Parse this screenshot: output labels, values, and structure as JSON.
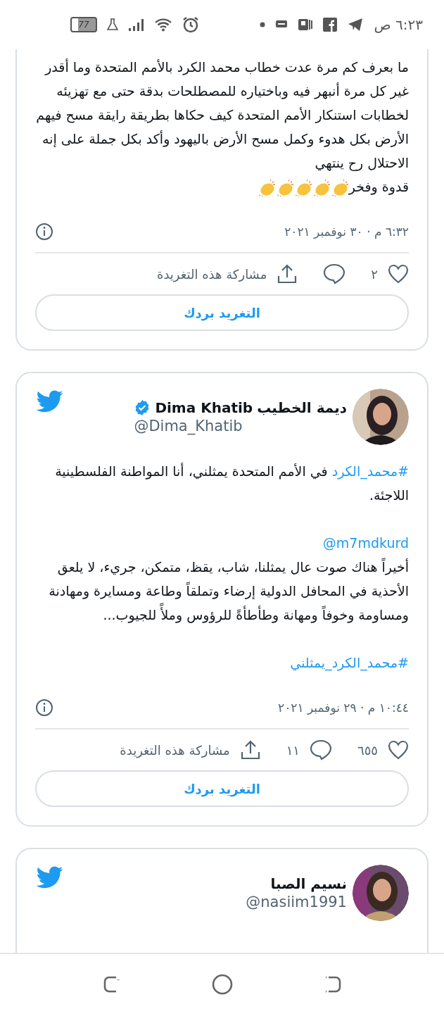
{
  "status_bar": {
    "time": "٦:٢٣ ص",
    "battery": "77"
  },
  "tweets": [
    {
      "cut_top": true,
      "paragraphs": [
        [
          {
            "kind": "text",
            "text": "ما بعرف كم مرة عدت خطاب محمد الكرد بالأمم المتحدة وما أقدر غير كل مرة أنبهر فيه وباختياره للمصطلحات بدقة حتى مع تهزيئه لخطابات استنكار الأمم المتحدة كيف حكاها بطريقة رايقة مسح فيهم الأرض بكل هدوء وكمل مسح الأرض باليهود وأكد بكل جملة على إنه الاحتلال رح ينتهي"
          },
          {
            "kind": "break"
          },
          {
            "kind": "text",
            "text": "قدوة وفخر"
          },
          {
            "kind": "claps"
          }
        ]
      ],
      "timestamp": "٦:٣٢ م · ٣٠ نوفمبر ٢٠٢١",
      "likes": "٢",
      "share": "مشاركة هذه التغريدة",
      "reply_button": "التغريد بردك"
    },
    {
      "cut_top": false,
      "header": {
        "name": "ديمة الخطيب",
        "name_latin": "Dima Khatib",
        "verified": true,
        "handle": "@Dima_Khatib"
      },
      "paragraphs": [
        [
          {
            "kind": "hashtag",
            "text": "#محمد_الكرد"
          },
          {
            "kind": "text",
            "text": " في الأمم المتحدة يمثلني، أنا المواطنة الفلسطينية اللاجئة."
          }
        ],
        [
          {
            "kind": "mention",
            "text": "@m7mdkurd"
          },
          {
            "kind": "break"
          },
          {
            "kind": "text",
            "text": "أخيراً هناك صوت عال يمثلنا، شاب، يقظ، متمكن، جريء، لا يلعق الأحذية في المحافل الدولية إرضاء وتملقاً وطاعة ومسايرة ومهادنة ومساومة وخوفاً ومهانة وطأطأةً للرؤوس وملأً للجيوب..."
          }
        ],
        [
          {
            "kind": "hashtag",
            "text": "#محمد_الكرد_يمثلني"
          }
        ]
      ],
      "timestamp": "١٠:٤٤ م · ٢٩ نوفمبر ٢٠٢١",
      "likes": "٦٥٥",
      "replies": "١١",
      "share": "مشاركة هذه التغريدة",
      "reply_button": "التغريد بردك"
    },
    {
      "cut_top": false,
      "header": {
        "name": "نسيم الصبا",
        "verified": false,
        "handle": "@nasiim1991"
      }
    }
  ]
}
